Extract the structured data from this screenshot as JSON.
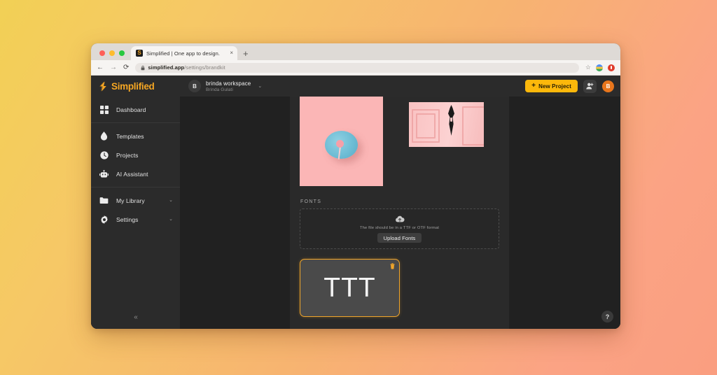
{
  "browser": {
    "tab": {
      "title": "Simplified | One app to design.",
      "favicon": "S",
      "close_label": "×"
    },
    "newtab_label": "+",
    "nav": {
      "back": "←",
      "forward": "→",
      "reload": "⟳"
    },
    "omnibox": {
      "lock": "🔒",
      "domain": "simplified.app",
      "path": "/settings/brandkit"
    },
    "actions": {
      "bookmark": "☆"
    }
  },
  "sidebar": {
    "logo": "Simplified",
    "groups": [
      {
        "items": [
          {
            "label": "Dashboard",
            "icon": "grid-icon",
            "expandable": false
          }
        ]
      },
      {
        "items": [
          {
            "label": "Templates",
            "icon": "drop-icon",
            "expandable": false
          },
          {
            "label": "Projects",
            "icon": "clock-icon",
            "expandable": false
          },
          {
            "label": "AI Assistant",
            "icon": "robot-icon",
            "expandable": false
          }
        ]
      },
      {
        "items": [
          {
            "label": "My Library",
            "icon": "folder-icon",
            "expandable": true,
            "chevron": "⌄"
          },
          {
            "label": "Settings",
            "icon": "gear-icon",
            "expandable": true,
            "chevron": "⌄"
          }
        ]
      }
    ],
    "collapse_label": "«"
  },
  "topbar": {
    "workspace": {
      "initial": "B",
      "name": "brinda workspace",
      "owner": "Brinda Gulati",
      "chevron": "⌄"
    },
    "new_project": {
      "plus": "+",
      "label": "New Project"
    },
    "invite_icon": "add-user-icon",
    "avatar": "B"
  },
  "main": {
    "fonts_section_label": "FONTS",
    "dropzone": {
      "icon": "cloud-upload-icon",
      "hint": "The file should be in a TTF or OTF format",
      "button_label": "Upload Fonts"
    },
    "font_cards": [
      {
        "preview_text": "TTT",
        "delete_icon": "trash-icon",
        "selected": true
      }
    ],
    "images": [
      {
        "name": "pink-plate-lollipop-image"
      },
      {
        "name": "pink-door-handle-image"
      }
    ]
  },
  "help": {
    "label": "?"
  },
  "colors": {
    "brand_orange": "#f5a623",
    "accent_yellow": "#fcb80b",
    "avatar_orange": "#e8761c",
    "card_border": "#f0a52a",
    "bg_gradient_start": "#f2d055",
    "bg_gradient_end": "#fa9e80"
  }
}
